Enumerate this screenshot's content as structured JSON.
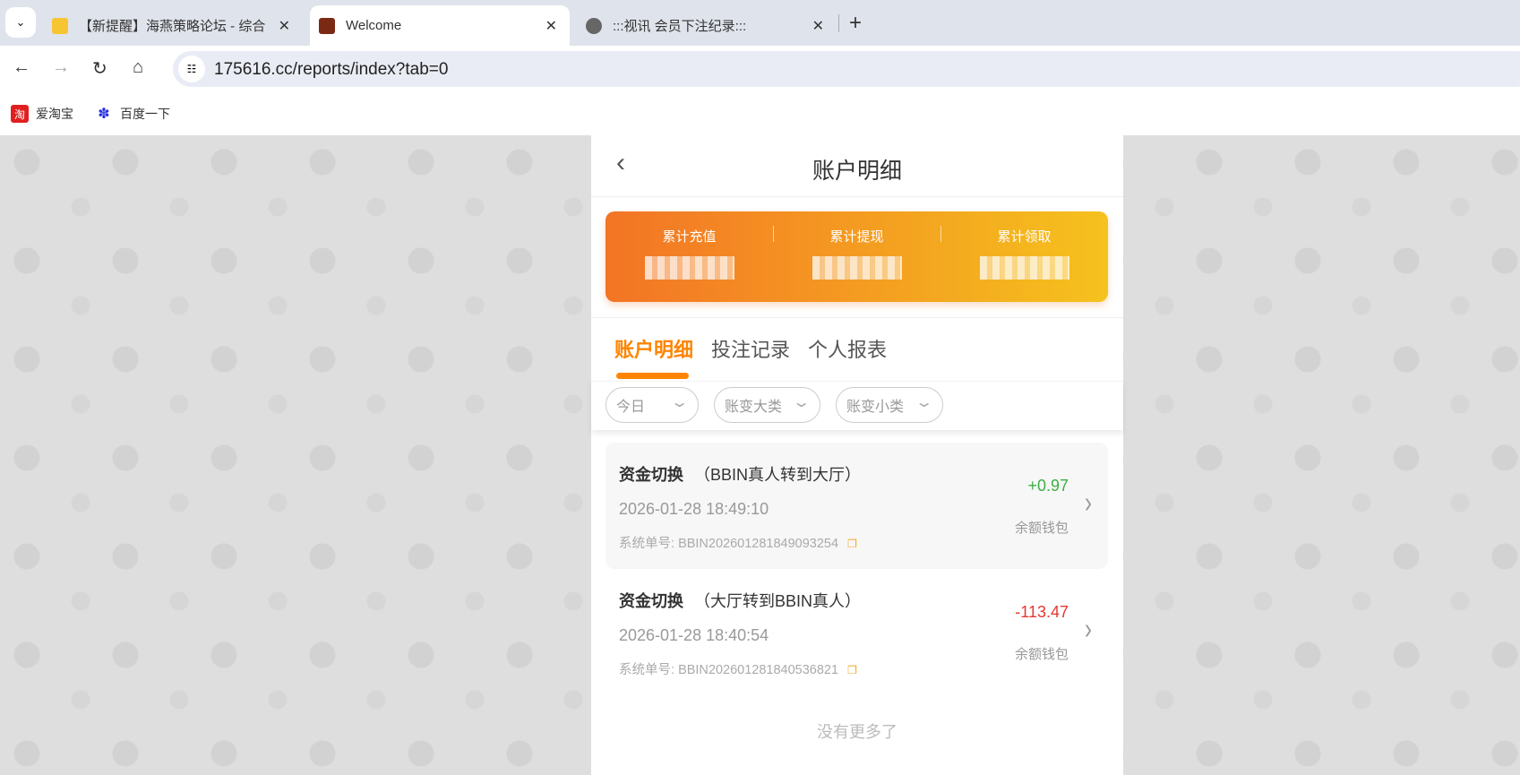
{
  "browser": {
    "tabs": [
      {
        "title": "【新提醒】海燕策略论坛 - 综合",
        "icon": "notification-icon",
        "active": false
      },
      {
        "title": "Welcome",
        "icon": "site-logo-icon",
        "active": true
      },
      {
        "title": ":::视讯 会员下注纪录:::",
        "icon": "globe-icon",
        "active": false
      }
    ],
    "url": "175616.cc/reports/index?tab=0",
    "bookmarks": [
      {
        "label": "爱淘宝",
        "icon": "taobao-icon"
      },
      {
        "label": "百度一下",
        "icon": "baidu-icon"
      }
    ]
  },
  "page": {
    "title": "账户明细",
    "stats": [
      {
        "label": "累计充值"
      },
      {
        "label": "累计提现"
      },
      {
        "label": "累计领取"
      }
    ],
    "tabs": [
      {
        "label": "账户明细",
        "active": true
      },
      {
        "label": "投注记录"
      },
      {
        "label": "个人报表"
      }
    ],
    "filters": [
      {
        "value": "今日"
      },
      {
        "value": "账变大类"
      },
      {
        "value": "账变小类"
      }
    ],
    "records": [
      {
        "type": "资金切换",
        "detail": "（BBIN真人转到大厅）",
        "time": "2026-01-28 18:49:10",
        "order_label": "系统单号:",
        "order_no": "BBIN202601281849093254",
        "amount": "+0.97",
        "amount_color": "#3cb043",
        "wallet": "余额钱包"
      },
      {
        "type": "资金切换",
        "detail": "（大厅转到BBIN真人）",
        "time": "2026-01-28 18:40:54",
        "order_label": "系统单号:",
        "order_no": "BBIN202601281840536821",
        "amount": "-113.47",
        "amount_color": "#e53935",
        "wallet": "余额钱包"
      }
    ],
    "no_more": "没有更多了",
    "accent": "#ff8400"
  }
}
